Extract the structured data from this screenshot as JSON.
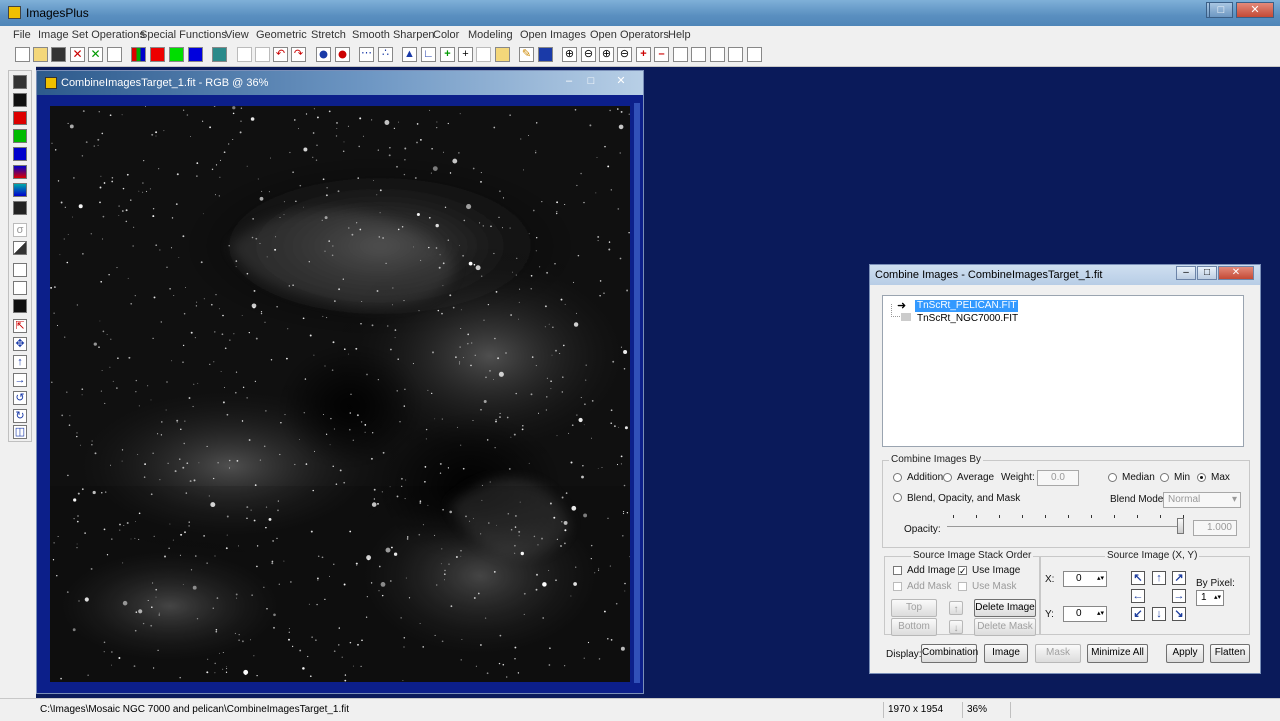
{
  "app": {
    "title": "ImagesPlus"
  },
  "menu": [
    "File",
    "Image Set Operations",
    "Special Functions",
    "View",
    "Geometric",
    "Stretch",
    "Smooth Sharpen",
    "Color",
    "Modeling",
    "Open Images",
    "Open Operators",
    "Help"
  ],
  "image_window": {
    "title": "CombineImagesTarget_1.fit - RGB @ 36%"
  },
  "dialog": {
    "title": "Combine Images - CombineImagesTarget_1.fit",
    "tree_items": [
      "TnScRt_PELICAN.FIT",
      "TnScRt_NGC7000.FIT"
    ],
    "combine_group": {
      "label": "Combine Images By",
      "addition": "Addition",
      "average": "Average",
      "weight_label": "Weight:",
      "weight_value": "0.0",
      "median": "Median",
      "min": "Min",
      "max": "Max",
      "blend": "Blend, Opacity, and Mask",
      "blend_mode_label": "Blend Mode:",
      "blend_mode_value": "Normal",
      "opacity_label": "Opacity:",
      "opacity_value": "1.000"
    },
    "stack_group": {
      "label": "Source Image Stack Order",
      "add_image": "Add Image",
      "use_image": "Use Image",
      "add_mask": "Add Mask",
      "use_mask": "Use Mask",
      "top": "Top",
      "bottom": "Bottom",
      "delete_image": "Delete Image",
      "delete_mask": "Delete Mask"
    },
    "source_group": {
      "label": "Source Image (X, Y)",
      "x_label": "X:",
      "x_value": "0",
      "y_label": "Y:",
      "y_value": "0",
      "by_pixel_label": "By Pixel:",
      "by_pixel_value": "1"
    },
    "display_label": "Display:",
    "buttons": {
      "combination": "Combination",
      "image": "Image",
      "mask": "Mask",
      "minimize_all": "Minimize All",
      "apply": "Apply",
      "flatten": "Flatten"
    }
  },
  "status": {
    "path": "C:\\Images\\Mosaic NGC 7000 and pelican\\CombineImagesTarget_1.fit",
    "dimensions": "1970 x 1954",
    "zoom": "36%"
  }
}
